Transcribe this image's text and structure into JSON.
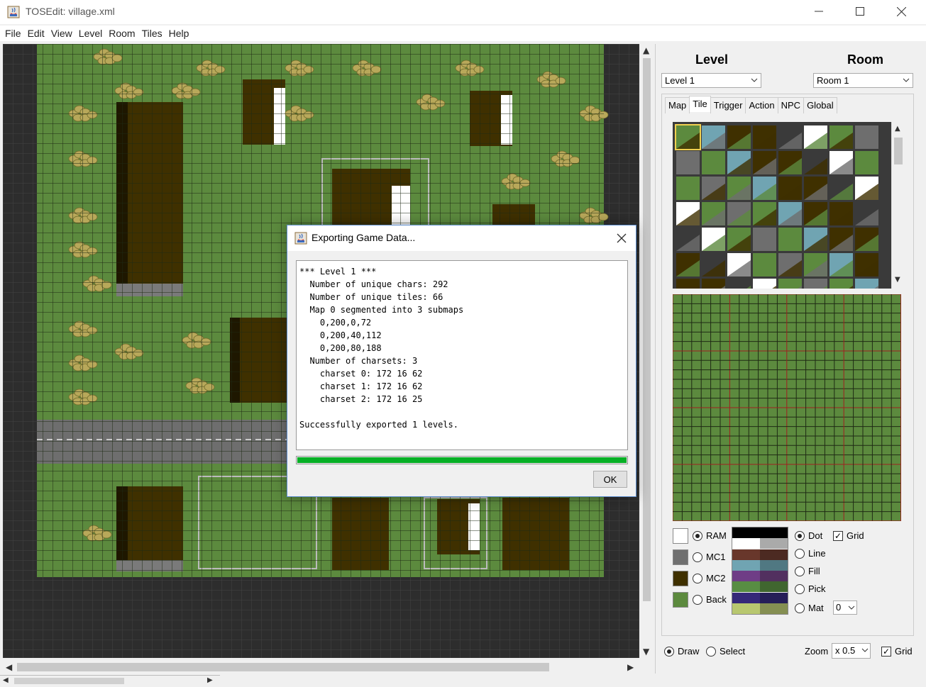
{
  "window": {
    "title": "TOSEdit: village.xml"
  },
  "menu": [
    "File",
    "Edit",
    "View",
    "Level",
    "Room",
    "Tiles",
    "Help"
  ],
  "right_panel": {
    "level_heading": "Level",
    "room_heading": "Room",
    "level_select": "Level 1",
    "room_select": "Room 1",
    "tabs": [
      "Map",
      "Tile",
      "Trigger",
      "Action",
      "NPC",
      "Global"
    ],
    "active_tab": "Tile",
    "color_modes": [
      "RAM",
      "MC1",
      "MC2",
      "Back"
    ],
    "selected_color_mode": "RAM",
    "color_swatches": [
      "#ffffff",
      "#707070",
      "#3f3000",
      "#5c8a3e"
    ],
    "palette_colors": [
      [
        "#000000",
        "#000000"
      ],
      [
        "#ffffff",
        "#aaaaaa"
      ],
      [
        "#68372b",
        "#4c2a22"
      ],
      [
        "#70a4b2",
        "#507882"
      ],
      [
        "#6f3d86",
        "#52305f"
      ],
      [
        "#588d43",
        "#40662f"
      ],
      [
        "#352879",
        "#261e58"
      ],
      [
        "#b8c76f",
        "#858f52"
      ]
    ],
    "draw_tools": [
      "Dot",
      "Line",
      "Fill",
      "Pick",
      "Mat"
    ],
    "selected_draw_tool": "Dot",
    "grid_label": "Grid",
    "mat_value": "0",
    "bottom": {
      "draw_label": "Draw",
      "select_label": "Select",
      "zoom_label": "Zoom",
      "zoom_value": "x 0.5",
      "grid_label": "Grid",
      "mode": "Draw"
    }
  },
  "dialog": {
    "title": "Exporting Game Data...",
    "log_lines": [
      "*** Level 1 ***",
      "  Number of unique chars: 292",
      "  Number of unique tiles: 66",
      "  Map 0 segmented into 3 submaps",
      "    0,200,0,72",
      "    0,200,40,112",
      "    0,200,80,188",
      "  Number of charsets: 3",
      "    charset 0: 172 16 62",
      "    charset 1: 172 16 62",
      "    charset 2: 172 16 25",
      "",
      "Successfully exported 1 levels."
    ],
    "progress": 1.0,
    "ok_label": "OK"
  },
  "colors": {
    "grass": "#5c8a3e",
    "road": "#6e6e6e",
    "border": "#2d2d2d",
    "building": "#3f3000",
    "progress": "#06b025"
  },
  "icons": [
    "java-app-icon",
    "minimize-icon",
    "maximize-icon",
    "close-icon",
    "chevron-down-icon",
    "scroll-arrow-icon"
  ]
}
